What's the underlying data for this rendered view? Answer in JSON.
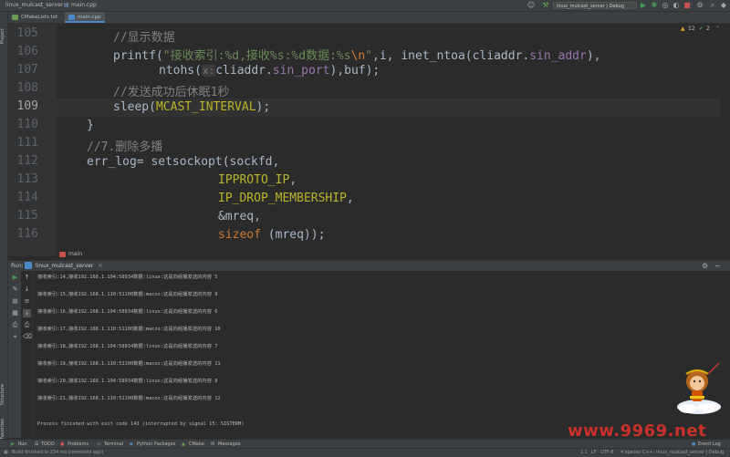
{
  "window": {
    "project": "linux_mulcast_server",
    "breadcrumb_file": "main.cpp",
    "run_config": "linux_mulcast_server | Debug"
  },
  "tabs": [
    {
      "label": "CMakeLists.txt",
      "active": false
    },
    {
      "label": "main.cpp",
      "active": true
    }
  ],
  "side_labels": {
    "project": "Project",
    "structure": "Structure",
    "favorites": "Favorites"
  },
  "editor": {
    "line_numbers": [
      "105",
      "106",
      "107",
      "108",
      "109",
      "110",
      "111",
      "112",
      "113",
      "114",
      "115",
      "116"
    ],
    "current_line": "109",
    "indicators": {
      "warnings": "12",
      "checks": "2"
    },
    "lines": {
      "l105_comment": "//显示数据",
      "l106_fn": "printf(",
      "l106_str": "\"接收索引:%d,接收%s:%d数据:%s",
      "l106_esc": "\\n",
      "l106_strend": "\"",
      "l106_args": ",i, inet_ntoa(cliaddr.",
      "l106_field": "sin_addr",
      "l106_end": "),",
      "l107_fn": "ntohs(",
      "l107_hint": "x:",
      "l107_mid": "cliaddr.",
      "l107_field": "sin_port",
      "l107_end": "),buf);",
      "l108_comment": "//发送成功后休眠1秒",
      "l109_fn": "sleep(",
      "l109_macro": "MCAST_INTERVAL",
      "l109_end": ");",
      "l110": "}",
      "l111_comment": "//7.删除多播",
      "l112": "err_log= setsockopt(sockfd,",
      "l113_macro": "IPPROTO_IP",
      "l113_end": ",",
      "l114_macro": "IP_DROP_MEMBERSHIP",
      "l114_end": ",",
      "l115": "&mreq,",
      "l116_kw": "sizeof",
      "l116_end": " (mreq));"
    },
    "function_crumb": "main"
  },
  "run": {
    "tab_label": "Run:",
    "config_label": "linux_mulcast_server",
    "console_lines": [
      "接收索引:14,接收192.168.1.104:58934数据:linux:这是向组播发送的内容 5",
      "接收索引:15,接收192.168.1.110:51100数据:macos:这是向组播发送的内容 9",
      "接收索引:16,接收192.168.1.104:58934数据:linux:这是向组播发送的内容 6",
      "接收索引:17,接收192.168.1.110:51100数据:macos:这是向组播发送的内容 10",
      "接收索引:18,接收192.168.1.104:58934数据:linux:这是向组播发送的内容 7",
      "接收索引:19,接收192.168.1.110:51100数据:macos:这是向组播发送的内容 11",
      "接收索引:20,接收192.168.1.104:58934数据:linux:这是向组播发送的内容 8",
      "接收索引:21,接收192.168.1.110:51100数据:macos:这是向组播发送的内容 12"
    ],
    "exit_line": "Process finished with exit code 143 (interrupted by signal 15: SIGTERM)"
  },
  "toolwindows": {
    "run": "Run",
    "todo": "TODO",
    "problems": "Problems",
    "terminal": "Terminal",
    "python_packages": "Python Packages",
    "cmake": "CMake",
    "messages": "Messages",
    "event_log": "Event Log"
  },
  "status": {
    "build": "Build finished in 234 ms (moments ago)",
    "position": "1:1",
    "line_sep": "LF",
    "encoding": "UTF-8",
    "indent": "4 spaces",
    "context": "C++: linux_mulcast_server | Debug"
  },
  "watermark": "www.9969.net",
  "colors": {
    "accent": "#4a88c7",
    "run_green": "#499c54",
    "comment": "#808080",
    "string": "#6a8759",
    "keyword": "#cc7832",
    "macro": "#bbb529",
    "field": "#9876aa"
  }
}
